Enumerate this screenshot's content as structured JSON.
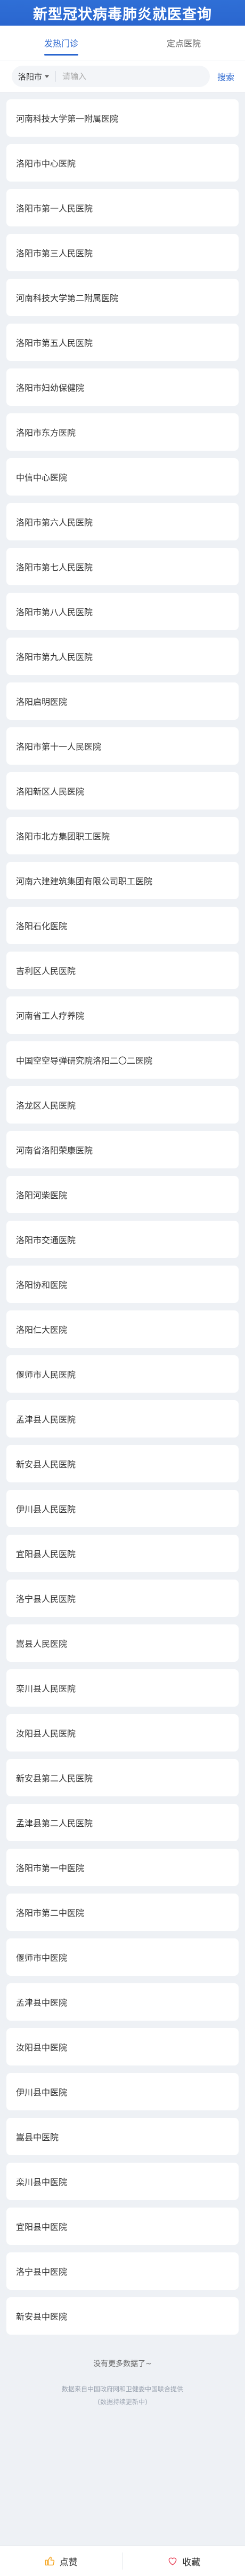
{
  "header": {
    "title": "新型冠状病毒肺炎就医查询"
  },
  "tabs": [
    {
      "label": "发热门诊",
      "active": true
    },
    {
      "label": "定点医院",
      "active": false
    }
  ],
  "search": {
    "city": "洛阳市",
    "placeholder": "请输入",
    "value": "",
    "button_label": "搜索"
  },
  "hospitals": [
    "河南科技大学第一附属医院",
    "洛阳市中心医院",
    "洛阳市第一人民医院",
    "洛阳市第三人民医院",
    "河南科技大学第二附属医院",
    "洛阳市第五人民医院",
    "洛阳市妇幼保健院",
    "洛阳市东方医院",
    "中信中心医院",
    "洛阳市第六人民医院",
    "洛阳市第七人民医院",
    "洛阳市第八人民医院",
    "洛阳市第九人民医院",
    "洛阳启明医院",
    "洛阳市第十一人民医院",
    "洛阳新区人民医院",
    "洛阳市北方集团职工医院",
    "河南六建建筑集团有限公司职工医院",
    "洛阳石化医院",
    "吉利区人民医院",
    "河南省工人疗养院",
    "中国空空导弹研究院洛阳二〇二医院",
    "洛龙区人民医院",
    "河南省洛阳荣康医院",
    "洛阳河柴医院",
    "洛阳市交通医院",
    "洛阳协和医院",
    "洛阳仁大医院",
    "偃师市人民医院",
    "孟津县人民医院",
    "新安县人民医院",
    "伊川县人民医院",
    "宜阳县人民医院",
    "洛宁县人民医院",
    "嵩县人民医院",
    "栾川县人民医院",
    "汝阳县人民医院",
    "新安县第二人民医院",
    "孟津县第二人民医院",
    "洛阳市第一中医院",
    "洛阳市第二中医院",
    "偃师市中医院",
    "孟津县中医院",
    "汝阳县中医院",
    "伊川县中医院",
    "嵩县中医院",
    "栾川县中医院",
    "宜阳县中医院",
    "洛宁县中医院",
    "新安县中医院"
  ],
  "footer_notes": {
    "no_more": "没有更多数据了~",
    "source_line1": "数据来自中国政府网和卫健委中国联合提供",
    "source_line2": "(数据持续更新中)"
  },
  "footer": {
    "like_label": "点赞",
    "favorite_label": "收藏"
  },
  "colors": {
    "brand": "#2a66cf",
    "background": "#eef1f5",
    "like_icon": "#f5a623",
    "favorite_icon": "#e84a5f"
  },
  "icons": {
    "like": "thumbs-up-icon",
    "favorite": "heart-icon",
    "city_dropdown": "chevron-down-icon"
  }
}
